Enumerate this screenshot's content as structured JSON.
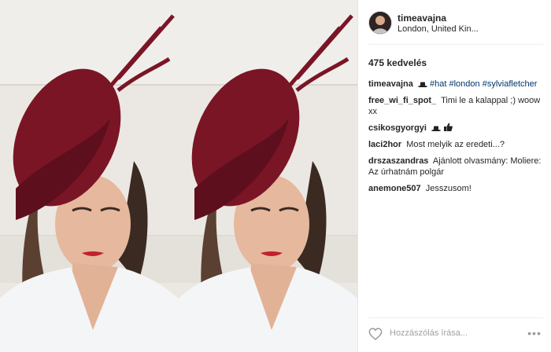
{
  "post": {
    "author": "timeavajna",
    "location": "London, United Kin..."
  },
  "likes": "475 kedvelés",
  "caption": {
    "author": "timeavajna",
    "tags": [
      "#hat",
      "#london",
      "#sylviafletcher"
    ]
  },
  "comments": [
    {
      "author": "free_wi_fi_spot_",
      "text": "Timi le a kalappal ;) woow xx"
    },
    {
      "author": "csikosgyorgyi",
      "text": ""
    },
    {
      "author": "laci2hor",
      "text": "Most melyik az eredeti...?"
    },
    {
      "author": "drszaszandras",
      "text": "Ajánlott olvasmány: Moliere: Az úrhatnám polgár"
    },
    {
      "author": "anemone507",
      "text": "Jesszusom!"
    }
  ],
  "comment_box": {
    "placeholder": "Hozzászólás írása..."
  },
  "icons": {
    "like": "heart-icon",
    "options": "more-options-icon",
    "hat_emoji": "hat-emoji-icon",
    "thumbs_emoji": "thumbs-up-emoji-icon"
  },
  "colors": {
    "hat": "#7a1526",
    "tag_link": "#003569",
    "dress": "#f4f5f6"
  }
}
